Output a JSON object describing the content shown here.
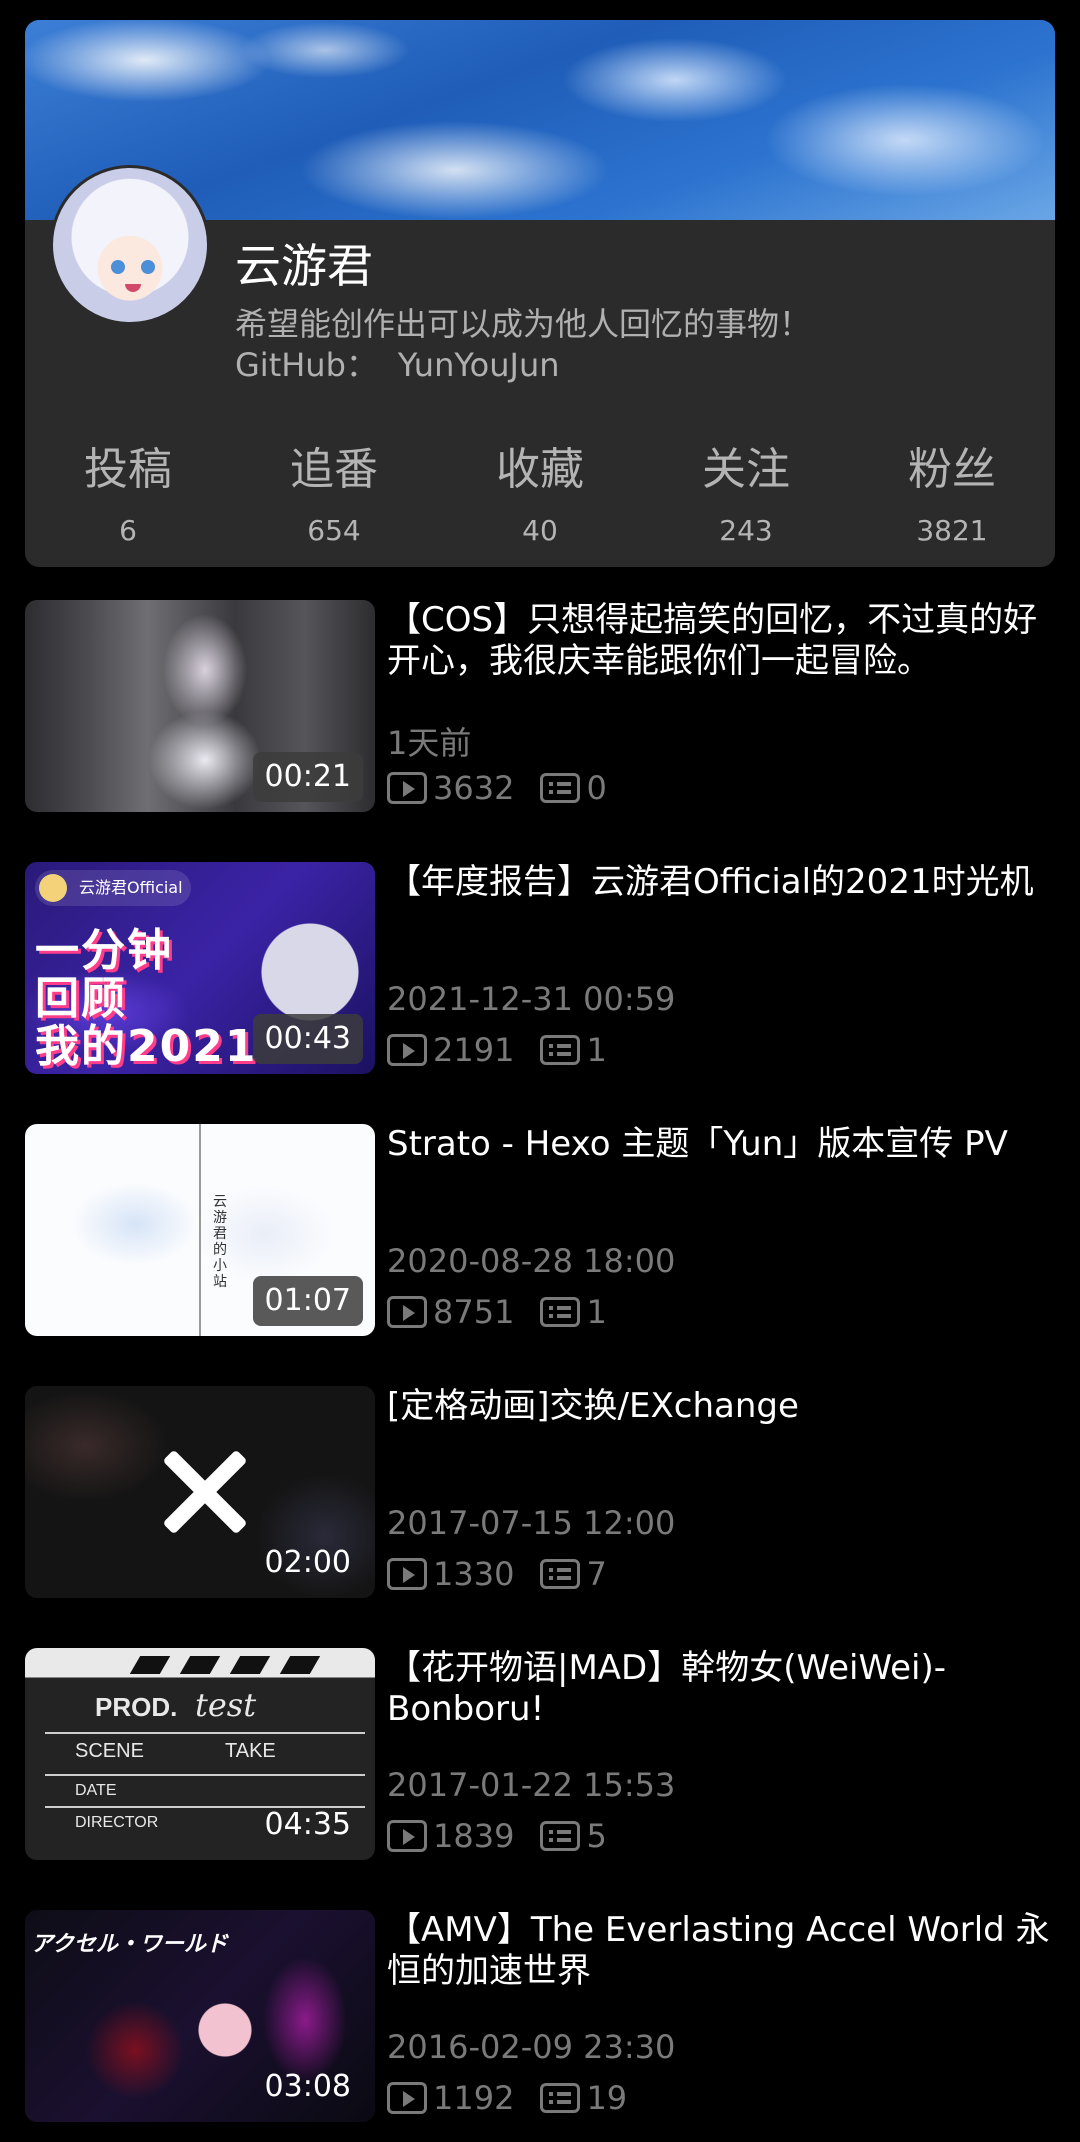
{
  "profile": {
    "name": "云游君",
    "bio": "希望能创作出可以成为他人回忆的事物！",
    "github_label": "GitHub：",
    "github_value": "YunYouJun"
  },
  "stats": [
    {
      "label": "投稿",
      "value": "6"
    },
    {
      "label": "追番",
      "value": "654"
    },
    {
      "label": "收藏",
      "value": "40"
    },
    {
      "label": "关注",
      "value": "243"
    },
    {
      "label": "粉丝",
      "value": "3821"
    }
  ],
  "videos": [
    {
      "title": "【COS】只想得起搞笑的回忆，不过真的好开心，我很庆幸能跟你们一起冒险。",
      "duration": "00:21",
      "date": "1天前",
      "plays": "3632",
      "comments": "0"
    },
    {
      "title": "【年度报告】云游君Official的2021时光机",
      "duration": "00:43",
      "date": "2021-12-31 00:59",
      "plays": "2191",
      "comments": "1",
      "thumb_badge": "云游君Official",
      "thumb_lines": [
        "一分钟",
        "回顾",
        "我的2021"
      ]
    },
    {
      "title": "Strato - Hexo 主题「Yun」版本宣传 PV",
      "duration": "01:07",
      "date": "2020-08-28 18:00",
      "plays": "8751",
      "comments": "1",
      "thumb_text": "云游君的小站"
    },
    {
      "title": "[定格动画]交换/EXchange",
      "duration": "02:00",
      "date": "2017-07-15 12:00",
      "plays": "1330",
      "comments": "7"
    },
    {
      "title": "【花开物语|MAD】幹物女(WeiWei)-Bonboru!",
      "duration": "04:35",
      "date": "2017-01-22 15:53",
      "plays": "1839",
      "comments": "5",
      "thumb_board": {
        "prod": "PROD.",
        "handwritten": "test",
        "scene": "SCENE",
        "take": "TAKE",
        "date": "DATE",
        "director": "DIRECTOR"
      }
    },
    {
      "title": "【AMV】The Everlasting Accel World 永恒的加速世界",
      "duration": "03:08",
      "date": "2016-02-09 23:30",
      "plays": "1192",
      "comments": "19",
      "thumb_text": "アクセル・ワールド"
    }
  ]
}
